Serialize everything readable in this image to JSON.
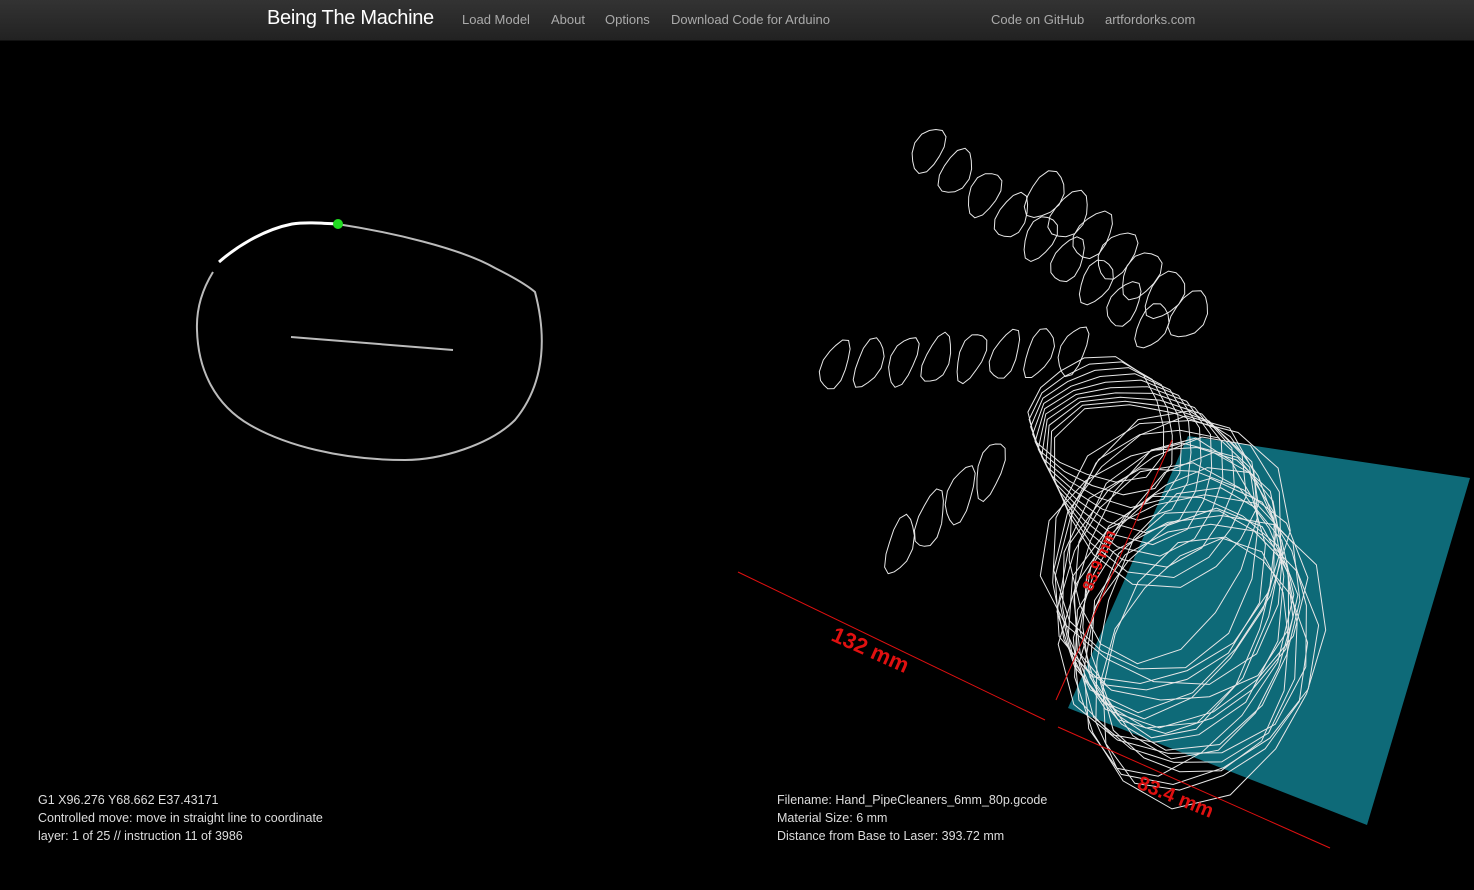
{
  "navbar": {
    "brand": "Being The Machine",
    "items": [
      "Load Model",
      "About",
      "Options",
      "Download Code for Arduino"
    ],
    "right_items": [
      "Code on GitHub",
      "artfordorks.com"
    ]
  },
  "instruction_panel": {
    "gcode": "G1 X96.276 Y68.662 E37.43171",
    "description": "Controlled move: move in straight line to coordinate",
    "progress": "layer: 1 of 25 // instruction 11 of 3986"
  },
  "file_panel": {
    "filename": "Filename: Hand_PipeCleaners_6mm_80p.gcode",
    "material": "Material Size: 6 mm",
    "distance": "Distance from Base to Laser: 393.72 mm"
  },
  "dimensions": {
    "width_label": "132 mm",
    "depth_label": "83.4 mm",
    "height_label": "83.9 mm"
  },
  "colors": {
    "background": "#000000",
    "navbar": "#2a2a2a",
    "toolpath": "#bbbbbb",
    "active_path": "#ffffff",
    "tool_head": "#22dd22",
    "laser_plane": "#0e6a78",
    "dimension_lines": "#e01010",
    "wireframe": "#e8e8e8"
  }
}
